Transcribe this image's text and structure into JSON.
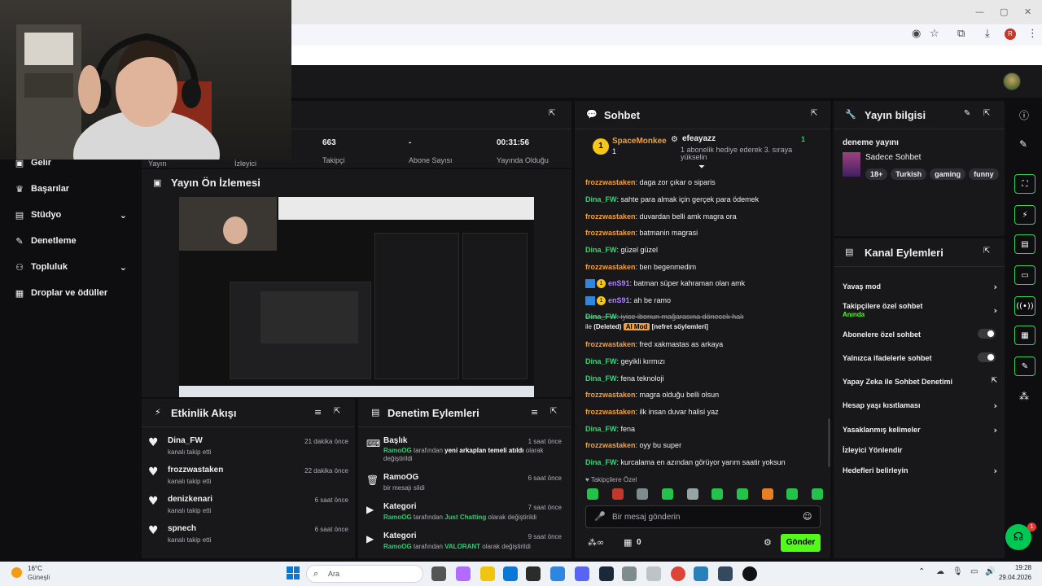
{
  "browser": {
    "profile_initial": "R"
  },
  "nav": {
    "items": [
      {
        "label": "Gelir"
      },
      {
        "label": "Başarılar"
      },
      {
        "label": "Stüdyo"
      },
      {
        "label": "Denetleme"
      },
      {
        "label": "Topluluk"
      },
      {
        "label": "Droplar ve ödüller"
      }
    ]
  },
  "stats": {
    "partial": {
      "label1": "Yayın",
      "label2": "İzleyici"
    },
    "followers": {
      "value": "663",
      "label": "Takipçi"
    },
    "subs": {
      "value": "-",
      "label": "Abone Sayısı"
    },
    "uptime": {
      "value": "00:31:56",
      "label": "Yayında Olduğu"
    }
  },
  "preview": {
    "title": "Yayın Ön İzlemesi"
  },
  "activity": {
    "title": "Etkinlik Akışı",
    "items": [
      {
        "name": "Dina_FW",
        "action": "kanalı takip etti",
        "time": "21 dakika önce"
      },
      {
        "name": "frozzwastaken",
        "action": "kanalı takip etti",
        "time": "22 dakika önce"
      },
      {
        "name": "denizkenari",
        "action": "kanalı takip etti",
        "time": "6 saat önce"
      },
      {
        "name": "spnech",
        "action": "kanalı takip etti",
        "time": "6 saat önce"
      }
    ]
  },
  "modactions": {
    "title": "Denetim Eylemleri",
    "items": [
      {
        "title": "Başlık",
        "time": "1 saat önce",
        "actor": "RamoOG",
        "mid": " tarafından ",
        "hl": "yeni arkaplan temeli atıldı",
        "tail": " olarak",
        "line2": "değiştirildi"
      },
      {
        "title": "RamoOG",
        "time": "6 saat önce",
        "actor": "",
        "mid": "",
        "hl": "",
        "tail": "",
        "line2": "bir mesajı sildi"
      },
      {
        "title": "Kategori",
        "time": "7 saat önce",
        "actor": "RamoOG",
        "mid": " tarafından ",
        "hl": "Just Chatting",
        "tail": " olarak değiştirildi",
        "line2": ""
      },
      {
        "title": "Kategori",
        "time": "9 saat önce",
        "actor": "RamoOG",
        "mid": " tarafından ",
        "hl": "VALORANT",
        "tail": " olarak değiştirildi",
        "line2": ""
      }
    ]
  },
  "chat": {
    "title": "Sohbet",
    "pinned": {
      "user1": "SpaceMonkee",
      "user1_count": "1",
      "user2": "efeayazz",
      "gift_line1": "1 abonelik hediye ederek 3. sıraya",
      "gift_line2": "yükselin",
      "right_count": "1"
    },
    "messages": [
      {
        "user": "frozzwastaken",
        "color": "orange",
        "text": ": daga zor çıkar o siparis"
      },
      {
        "user": "Dina_FW",
        "color": "green",
        "text": ": sahte para almak için gerçek para ödemek"
      },
      {
        "user": "frozzwastaken",
        "color": "orange",
        "text": ": duvardan belli amk magra ora"
      },
      {
        "user": "frozzwastaken",
        "color": "orange",
        "text": ": batmanin magrasi"
      },
      {
        "user": "Dina_FW",
        "color": "green",
        "text": ": güzel güzel"
      },
      {
        "user": "frozzwastaken",
        "color": "orange",
        "text": ": ben begenmedim"
      },
      {
        "user": "enS91",
        "color": "purple",
        "text": ": batman süper kahraman olan amk"
      },
      {
        "user": "enS91",
        "color": "purple",
        "text": ": ah be ramo"
      },
      {
        "user": "Dina_FW",
        "color": "green",
        "text": ": iyice ibonun mağarasına dönecek halı"
      },
      {
        "user": "frozzwastaken",
        "color": "orange",
        "text": ": fred xakmastas as arkaya"
      },
      {
        "user": "Dina_FW",
        "color": "green",
        "text": ": geyikli kırmızı"
      },
      {
        "user": "Dina_FW",
        "color": "green",
        "text": ": fena teknoloji"
      },
      {
        "user": "frozzwastaken",
        "color": "orange",
        "text": ": magra olduğu belli olsun"
      },
      {
        "user": "frozzwastaken",
        "color": "orange",
        "text": ": ilk insan duvar halisi yaz"
      },
      {
        "user": "Dina_FW",
        "color": "green",
        "text": ": fena"
      },
      {
        "user": "frozzwastaken",
        "color": "orange",
        "text": ": oyy bu super"
      },
      {
        "user": "Dina_FW",
        "color": "green",
        "text": ": kurcalama en azından görüyor yarım saatir yoksun"
      }
    ],
    "badge_count": "1",
    "deleted": {
      "prefix": "ile ",
      "deleted_label": "(Deleted)",
      "ai_label": "AI Mod",
      "reason": "[nefret söylemleri]"
    },
    "followers_only": "Takipçilere Özel",
    "input_placeholder": "Bir mesaj gönderin",
    "points": "0",
    "send_label": "Gönder"
  },
  "streaminfo": {
    "title": "Yayın bilgisi",
    "stream_title": "deneme yayını",
    "category": "Sadece Sohbet",
    "tags": [
      "18+",
      "Turkish",
      "gaming",
      "funny"
    ]
  },
  "channel_actions": {
    "title": "Kanal Eylemleri",
    "items": [
      {
        "label": "Yavaş mod",
        "sub": ""
      },
      {
        "label": "Takipçilere özel sohbet",
        "sub": "Anında"
      },
      {
        "label": "Abonelere özel sohbet",
        "sub": ""
      },
      {
        "label": "Yalnızca ifadelerle sohbet",
        "sub": ""
      },
      {
        "label": "Yapay Zeka ile Sohbet Denetimi",
        "sub": ""
      },
      {
        "label": "Hesap yaşı kısıtlaması",
        "sub": ""
      },
      {
        "label": "Yasaklanmış kelimeler",
        "sub": ""
      },
      {
        "label": "İzleyici Yönlendir",
        "sub": ""
      },
      {
        "label": "Hedefleri belirleyin",
        "sub": ""
      }
    ]
  },
  "support_badge": "1",
  "taskbar": {
    "weather_temp": "16°C",
    "weather_label": "Güneşli",
    "search_placeholder": "Ara",
    "time": "19:28",
    "date": "29.04.2026"
  },
  "colors": {
    "accent": "#53fc18",
    "bg": "#0e0e10",
    "panel": "#18181b"
  }
}
